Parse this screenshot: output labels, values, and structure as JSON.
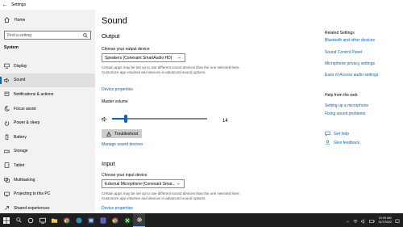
{
  "window": {
    "title": "Settings"
  },
  "sidebar": {
    "home_label": "Home",
    "search_placeholder": "Find a setting",
    "section_title": "System",
    "items": [
      {
        "label": "Display",
        "icon": "display-icon"
      },
      {
        "label": "Sound",
        "icon": "speaker-icon",
        "active": true
      },
      {
        "label": "Notifications & actions",
        "icon": "notifications-icon"
      },
      {
        "label": "Focus assist",
        "icon": "moon-icon"
      },
      {
        "label": "Power & sleep",
        "icon": "power-icon"
      },
      {
        "label": "Battery",
        "icon": "battery-icon"
      },
      {
        "label": "Storage",
        "icon": "storage-icon"
      },
      {
        "label": "Tablet",
        "icon": "tablet-icon"
      },
      {
        "label": "Multitasking",
        "icon": "multitasking-icon"
      },
      {
        "label": "Projecting to this PC",
        "icon": "projecting-icon"
      },
      {
        "label": "Shared experiences",
        "icon": "shared-icon"
      }
    ]
  },
  "main": {
    "title": "Sound",
    "output": {
      "heading": "Output",
      "device_label": "Choose your output device",
      "device_value": "Speakers (Conexant SmartAudio HD)",
      "note": "Certain apps may be set up to use different sound devices than the one selected here. Customize app volumes and devices in advanced sound options.",
      "properties_link": "Device properties",
      "volume_label": "Master volume",
      "volume_value": "14",
      "volume_level": 0.14,
      "troubleshoot_label": "Troubleshoot",
      "manage_link": "Manage sound devices"
    },
    "input": {
      "heading": "Input",
      "device_label": "Choose your input device",
      "device_value": "External Microphone (Conexant Smar...",
      "note": "Certain apps may be set up to use different sound devices than the one selected here. Customize app volumes and devices in advanced sound options.",
      "properties_link": "Device properties"
    }
  },
  "related": {
    "heading": "Related Settings",
    "links": [
      "Bluetooth and other devices",
      "Sound Control Panel",
      "Microphone privacy settings",
      "Ease of Access audio settings"
    ],
    "help_heading": "Help from the web",
    "help_links": [
      "Setting up a microphone",
      "Fixing sound problems"
    ],
    "get_help": "Get help",
    "feedback": "Give feedback"
  },
  "taskbar": {
    "time": "10:09 AM",
    "date": "11/7/2022"
  },
  "colors": {
    "accent": "#0067c0",
    "sidebar_bg": "#f2f2f2",
    "taskbar_bg": "#1f1f1f"
  }
}
